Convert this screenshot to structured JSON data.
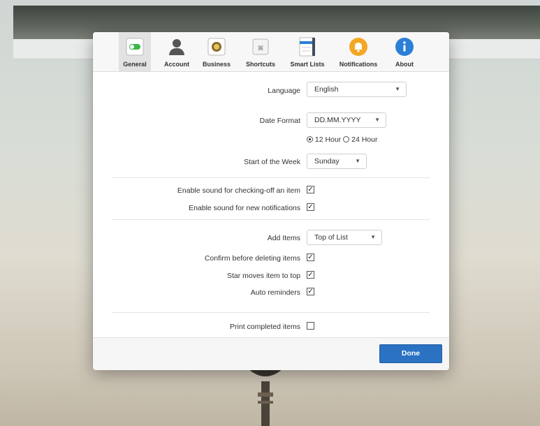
{
  "tabs": [
    {
      "label": "General",
      "icon": "toggle-icon"
    },
    {
      "label": "Account",
      "icon": "person-icon"
    },
    {
      "label": "Business",
      "icon": "badge-icon"
    },
    {
      "label": "Shortcuts",
      "icon": "command-key-icon"
    },
    {
      "label": "Smart Lists",
      "icon": "list-icon"
    },
    {
      "label": "Notifications",
      "icon": "bell-icon"
    },
    {
      "label": "About",
      "icon": "info-icon"
    }
  ],
  "general": {
    "language_label": "Language",
    "language_value": "English",
    "date_format_label": "Date Format",
    "date_format_value": "DD.MM.YYYY",
    "time_12": "12 Hour",
    "time_24": "24 Hour",
    "start_week_label": "Start of the Week",
    "start_week_value": "Sunday",
    "sound_check_label": "Enable sound for checking-off an item",
    "sound_notif_label": "Enable sound for new notifications",
    "add_items_label": "Add Items",
    "add_items_value": "Top of List",
    "confirm_delete_label": "Confirm before deleting items",
    "star_moves_label": "Star moves item to top",
    "auto_reminders_label": "Auto reminders",
    "print_completed_label": "Print completed items"
  },
  "shortcut_glyph": "⌘",
  "footer": {
    "done_label": "Done"
  },
  "colors": {
    "accent": "#2b72c2",
    "notifications": "#f5a623",
    "info": "#2b7fd6",
    "toggle": "#3cb54a"
  }
}
